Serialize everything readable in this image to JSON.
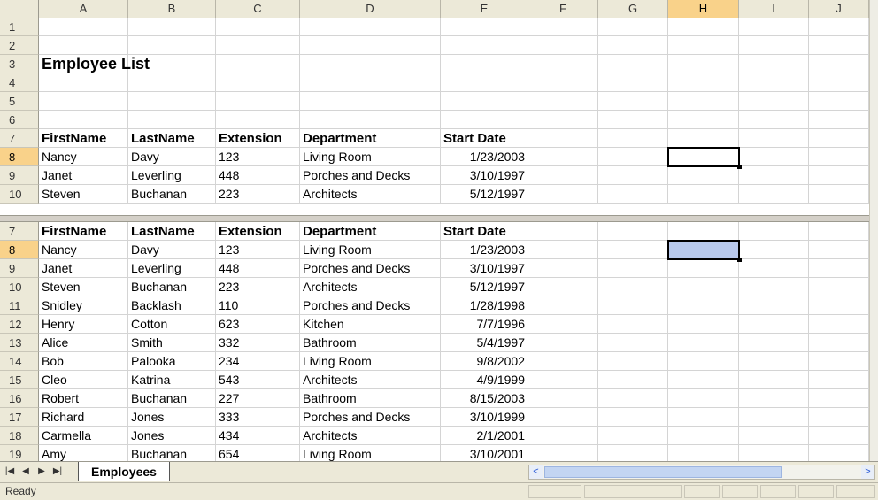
{
  "columns": [
    "A",
    "B",
    "C",
    "D",
    "E",
    "F",
    "G",
    "H",
    "I",
    "J"
  ],
  "selected_column": "H",
  "selected_row": "8",
  "top_pane": {
    "rows": [
      {
        "num": "1",
        "cells": [
          "",
          "",
          "",
          "",
          ""
        ]
      },
      {
        "num": "2",
        "cells": [
          "",
          "",
          "",
          "",
          ""
        ]
      },
      {
        "num": "3",
        "cells": [
          "Employee List",
          "",
          "",
          "",
          ""
        ],
        "style": "title"
      },
      {
        "num": "4",
        "cells": [
          "",
          "",
          "",
          "",
          ""
        ]
      },
      {
        "num": "5",
        "cells": [
          "",
          "",
          "",
          "",
          ""
        ]
      },
      {
        "num": "6",
        "cells": [
          "",
          "",
          "",
          "",
          ""
        ]
      },
      {
        "num": "7",
        "cells": [
          "FirstName",
          "LastName",
          "Extension",
          "Department",
          "Start Date"
        ],
        "style": "header"
      },
      {
        "num": "8",
        "cells": [
          "Nancy",
          "Davy",
          "123",
          "Living Room",
          "1/23/2003"
        ]
      },
      {
        "num": "9",
        "cells": [
          "Janet",
          "Leverling",
          "448",
          "Porches and Decks",
          "3/10/1997"
        ]
      },
      {
        "num": "10",
        "cells": [
          "Steven",
          "Buchanan",
          "223",
          "Architects",
          "5/12/1997"
        ]
      }
    ]
  },
  "bottom_pane": {
    "rows": [
      {
        "num": "7",
        "cells": [
          "FirstName",
          "LastName",
          "Extension",
          "Department",
          "Start Date"
        ],
        "style": "header"
      },
      {
        "num": "8",
        "cells": [
          "Nancy",
          "Davy",
          "123",
          "Living Room",
          "1/23/2003"
        ]
      },
      {
        "num": "9",
        "cells": [
          "Janet",
          "Leverling",
          "448",
          "Porches and Decks",
          "3/10/1997"
        ]
      },
      {
        "num": "10",
        "cells": [
          "Steven",
          "Buchanan",
          "223",
          "Architects",
          "5/12/1997"
        ]
      },
      {
        "num": "11",
        "cells": [
          "Snidley",
          "Backlash",
          "110",
          "Porches and Decks",
          "1/28/1998"
        ]
      },
      {
        "num": "12",
        "cells": [
          "Henry",
          "Cotton",
          "623",
          "Kitchen",
          "7/7/1996"
        ]
      },
      {
        "num": "13",
        "cells": [
          "Alice",
          "Smith",
          "332",
          "Bathroom",
          "5/4/1997"
        ]
      },
      {
        "num": "14",
        "cells": [
          "Bob",
          "Palooka",
          "234",
          "Living Room",
          "9/8/2002"
        ]
      },
      {
        "num": "15",
        "cells": [
          "Cleo",
          "Katrina",
          "543",
          "Architects",
          "4/9/1999"
        ]
      },
      {
        "num": "16",
        "cells": [
          "Robert",
          "Buchanan",
          "227",
          "Bathroom",
          "8/15/2003"
        ]
      },
      {
        "num": "17",
        "cells": [
          "Richard",
          "Jones",
          "333",
          "Porches and Decks",
          "3/10/1999"
        ]
      },
      {
        "num": "18",
        "cells": [
          "Carmella",
          "Jones",
          "434",
          "Architects",
          "2/1/2001"
        ]
      },
      {
        "num": "19",
        "cells": [
          "Amy",
          "Buchanan",
          "654",
          "Living Room",
          "3/10/2001"
        ]
      }
    ]
  },
  "tabs": {
    "sheet_name": "Employees",
    "nav": [
      "first-sheet-icon",
      "prev-sheet-icon",
      "next-sheet-icon",
      "last-sheet-icon"
    ]
  },
  "status": {
    "text": "Ready"
  },
  "colors": {
    "selected_header": "#f9d28a",
    "selected_cell_fill": "#b8c9ec",
    "header_bg": "#ece9d8"
  }
}
